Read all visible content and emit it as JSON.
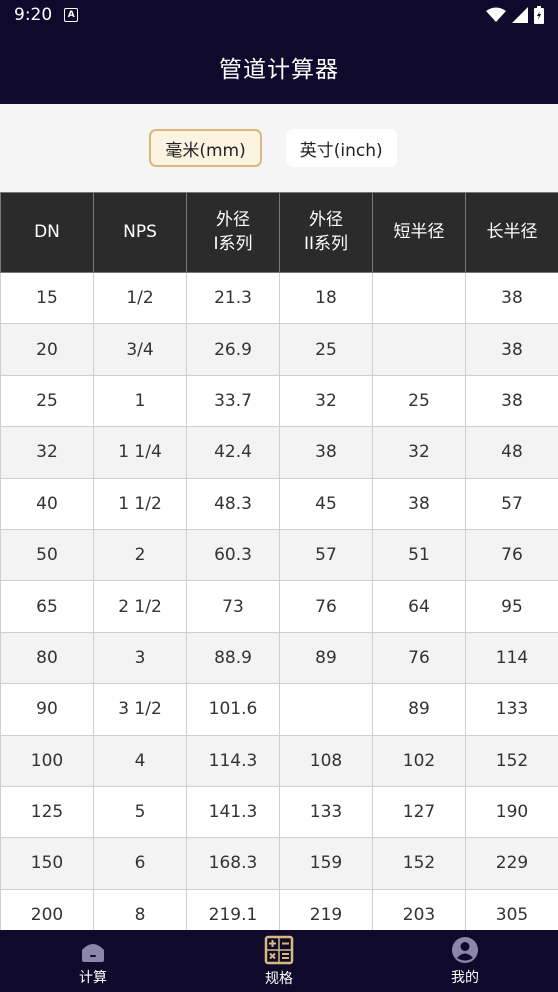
{
  "status_bar": {
    "time": "9:20",
    "notif_glyph": "A"
  },
  "app_bar": {
    "title": "管道计算器"
  },
  "units": {
    "mm_label": "毫米(mm)",
    "inch_label": "英寸(inch)",
    "selected": "mm"
  },
  "table": {
    "headers": [
      "DN",
      "NPS",
      "外径\nI系列",
      "外径\nII系列",
      "短半径",
      "长半径"
    ],
    "rows": [
      [
        "15",
        "1/2",
        "21.3",
        "18",
        "",
        "38"
      ],
      [
        "20",
        "3/4",
        "26.9",
        "25",
        "",
        "38"
      ],
      [
        "25",
        "1",
        "33.7",
        "32",
        "25",
        "38"
      ],
      [
        "32",
        "1 1/4",
        "42.4",
        "38",
        "32",
        "48"
      ],
      [
        "40",
        "1 1/2",
        "48.3",
        "45",
        "38",
        "57"
      ],
      [
        "50",
        "2",
        "60.3",
        "57",
        "51",
        "76"
      ],
      [
        "65",
        "2 1/2",
        "73",
        "76",
        "64",
        "95"
      ],
      [
        "80",
        "3",
        "88.9",
        "89",
        "76",
        "114"
      ],
      [
        "90",
        "3 1/2",
        "101.6",
        "",
        "89",
        "133"
      ],
      [
        "100",
        "4",
        "114.3",
        "108",
        "102",
        "152"
      ],
      [
        "125",
        "5",
        "141.3",
        "133",
        "127",
        "190"
      ],
      [
        "150",
        "6",
        "168.3",
        "159",
        "152",
        "229"
      ],
      [
        "200",
        "8",
        "219.1",
        "219",
        "203",
        "305"
      ]
    ]
  },
  "bottom_nav": {
    "items": [
      {
        "label": "计算",
        "icon": "home-icon"
      },
      {
        "label": "规格",
        "icon": "calculator-icon"
      },
      {
        "label": "我的",
        "icon": "profile-icon"
      }
    ],
    "active_index": 1
  },
  "colors": {
    "primary_dark": "#0f0a2b",
    "accent": "#d9b97c",
    "table_header": "#2b2b2b"
  }
}
